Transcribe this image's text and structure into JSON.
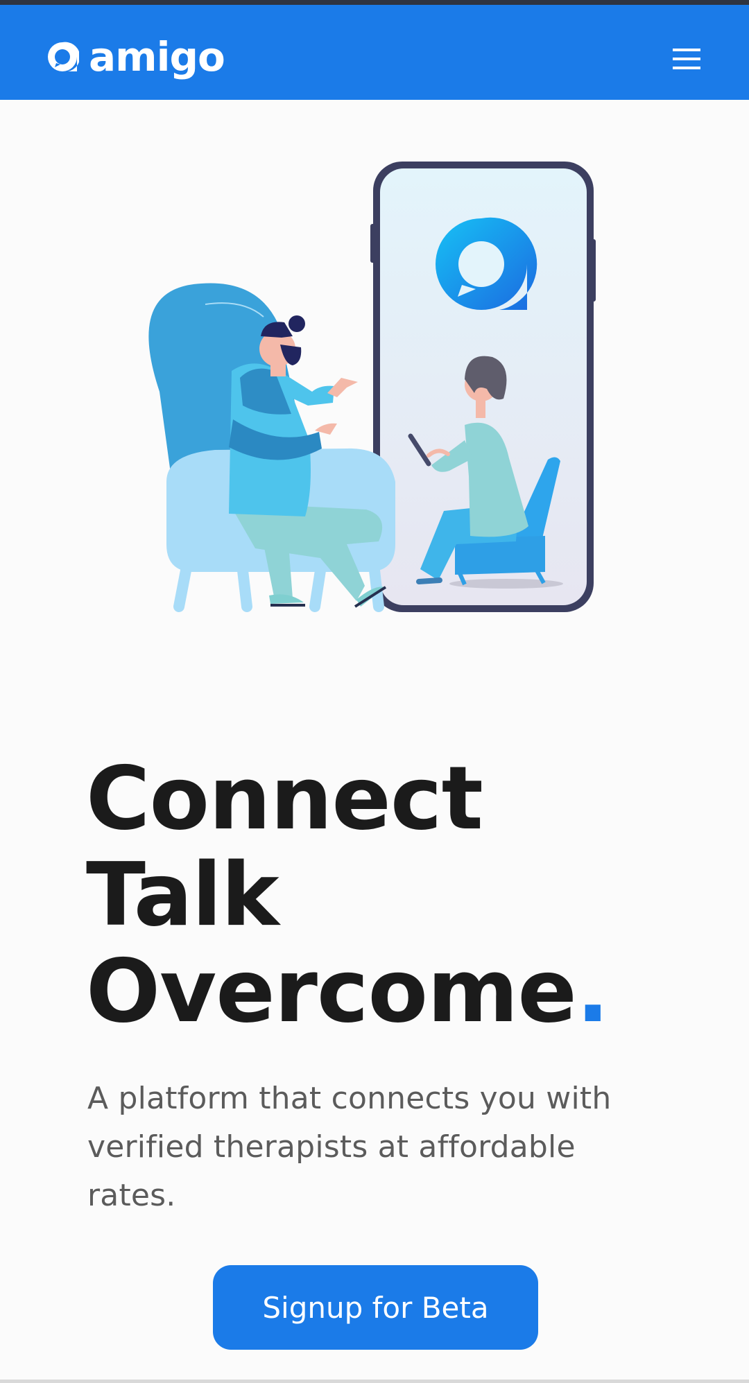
{
  "brand": {
    "name": "amigo",
    "primary_color": "#1b7be8",
    "logo_icon": "amigo-chat-bubble-icon"
  },
  "nav": {
    "menu_icon": "hamburger-menu-icon"
  },
  "hero": {
    "illustration": "therapy-session-illustration",
    "headline_lines": [
      "Connect",
      "Talk",
      "Overcome"
    ],
    "headline_accent": ".",
    "subtitle": "A platform that connects you with verified therapists at affordable rates.",
    "cta_label": "Signup for Beta"
  }
}
